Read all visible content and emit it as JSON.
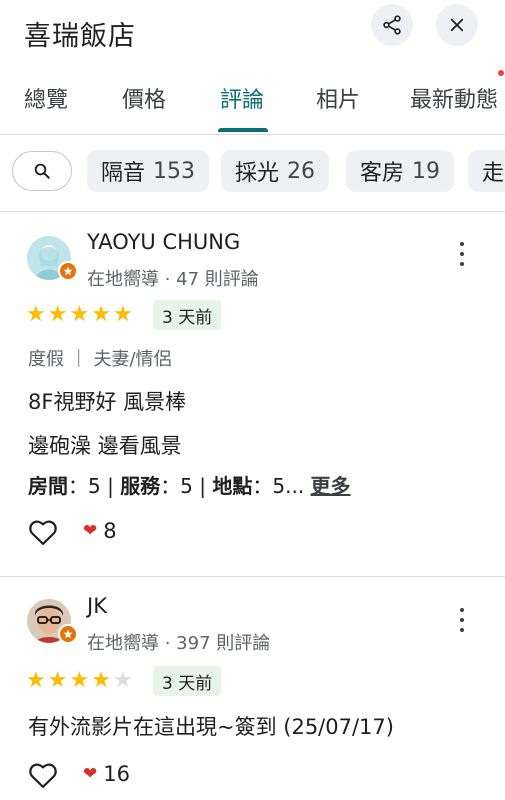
{
  "header": {
    "title": "喜瑞飯店"
  },
  "tabs": [
    {
      "label": "總覽"
    },
    {
      "label": "價格"
    },
    {
      "label": "評論"
    },
    {
      "label": "相片"
    },
    {
      "label": "最新動態"
    }
  ],
  "active_tab": "評論",
  "chips": [
    {
      "label": "隔音",
      "count": "153"
    },
    {
      "label": "採光",
      "count": "26"
    },
    {
      "label": "客房",
      "count": "19"
    },
    {
      "label": "走",
      "count": ""
    }
  ],
  "reviews": [
    {
      "name": "YAOYU CHUNG",
      "meta": "在地嚮導 · 47 則評論",
      "rating": 5,
      "time": "3 天前",
      "tags": "度假 ｜ 夫妻/情侶",
      "lines": [
        "8F視野好 風景棒",
        "邊砲澡 邊看風景"
      ],
      "ratings": {
        "k1": "房間",
        "v1": "：5 | ",
        "k2": "服務",
        "v2": "：5 | ",
        "k3": "地點",
        "v3": "：5...",
        "more": "更多"
      },
      "likes": "8"
    },
    {
      "name": "JK",
      "meta": "在地嚮導 · 397 則評論",
      "rating": 4,
      "time": "3 天前",
      "lines": [
        "有外流影片在這出現~簽到 (25/07/17)"
      ],
      "likes": "16"
    }
  ],
  "colors": {
    "accent": "#0b6e79",
    "star": "#fbbc04",
    "time_badge_bg": "#e6f4ea",
    "heart": "#d93025",
    "local_guide_badge": "#e8710a"
  },
  "icons": {
    "share": "share-icon",
    "close": "close-icon",
    "search": "search-icon",
    "more": "more-vert-icon",
    "like": "heart-outline-icon"
  }
}
